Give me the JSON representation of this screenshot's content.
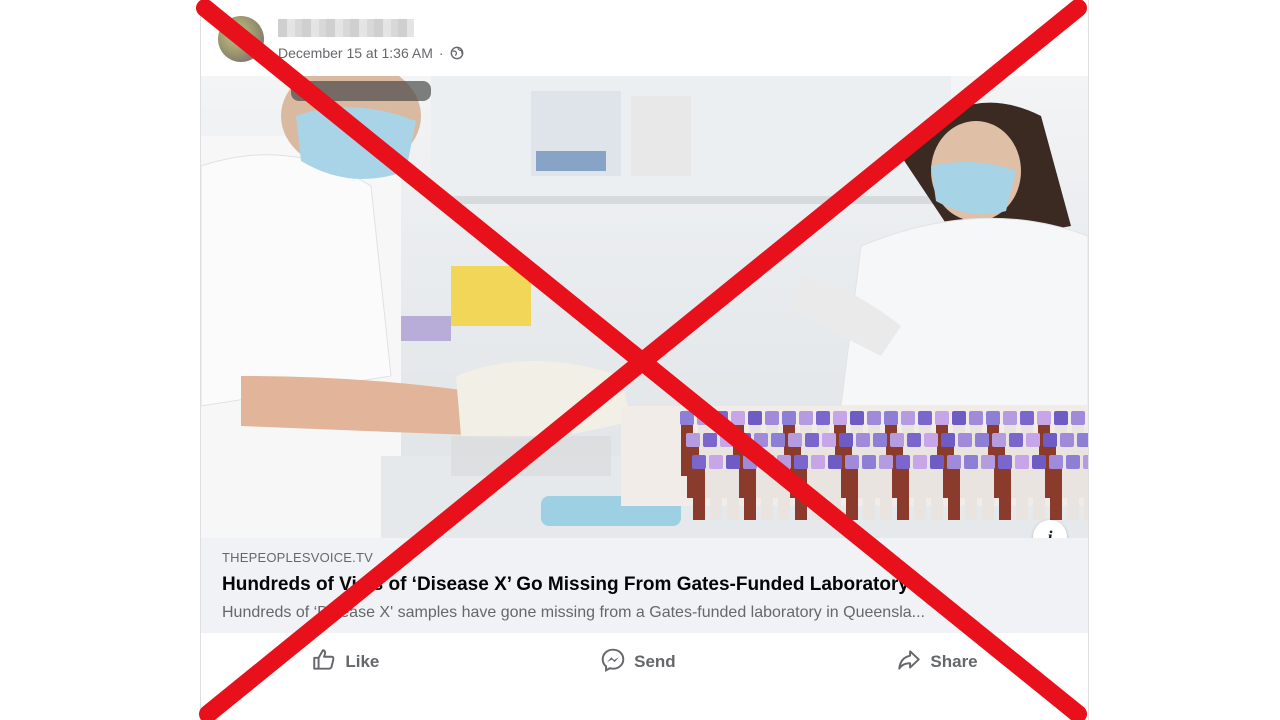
{
  "post": {
    "timestamp": "December 15 at 1:36 AM",
    "separator": "·",
    "privacy_icon": "globe-icon"
  },
  "link_preview": {
    "domain": "THEPEOPLESVOICE.TV",
    "headline": "Hundreds of Vials of ‘Disease X’ Go Missing From Gates-Funded Laboratory",
    "description": "Hundreds of ‘Disease X' samples have gone missing from a Gates-funded laboratory in Queensla...",
    "info_icon": "info-icon"
  },
  "actions": [
    {
      "label": "Like",
      "icon": "thumbs-up-icon"
    },
    {
      "label": "Send",
      "icon": "messenger-icon"
    },
    {
      "label": "Share",
      "icon": "share-arrow-icon"
    }
  ],
  "overlay": {
    "type": "red-cross",
    "color": "#e8101a"
  }
}
